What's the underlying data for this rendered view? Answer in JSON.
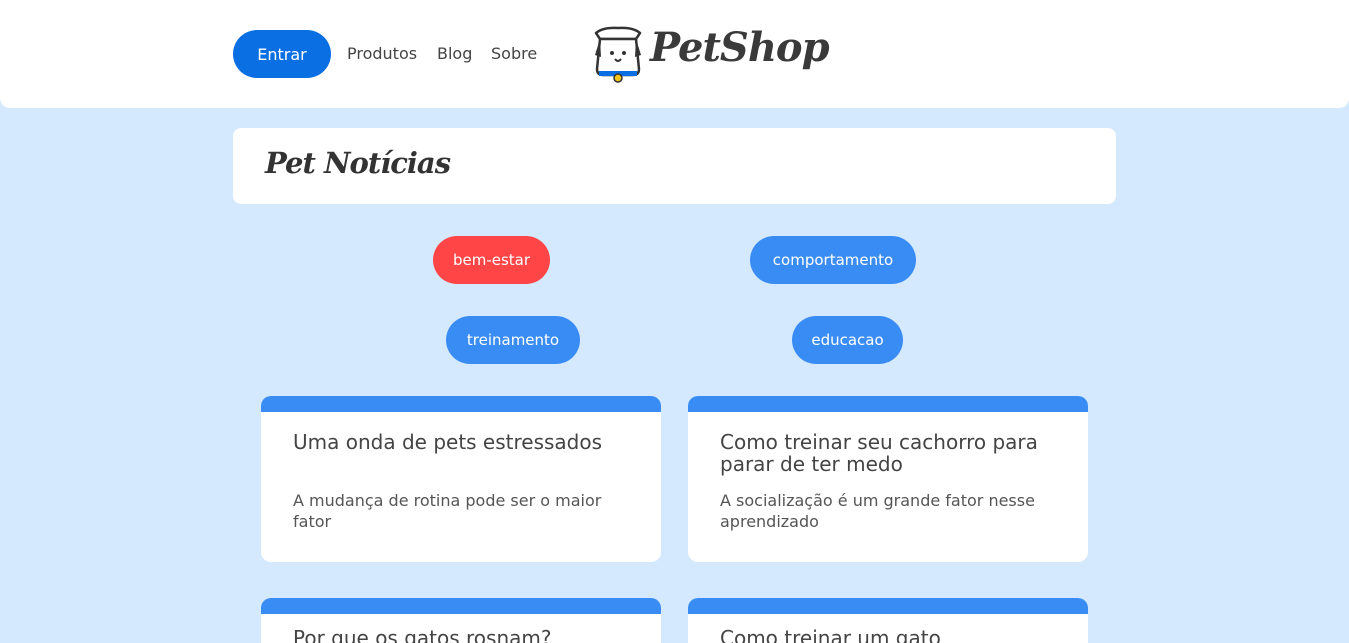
{
  "header": {
    "login_label": "Entrar",
    "nav": [
      "Produtos",
      "Blog",
      "Sobre"
    ],
    "logo_text": "PetShop"
  },
  "page": {
    "title": "Pet Notícias"
  },
  "tags": [
    {
      "label": "bem-estar",
      "color": "#ff4545"
    },
    {
      "label": "comportamento",
      "color": "#3a8cf5"
    },
    {
      "label": "treinamento",
      "color": "#3a8cf5"
    },
    {
      "label": "educacao",
      "color": "#3a8cf5"
    }
  ],
  "cards": [
    {
      "title": "Uma onda de pets estressados",
      "description": "A mudança de rotina pode ser o maior fator"
    },
    {
      "title": "Como treinar seu cachorro para parar de ter medo",
      "description": "A socialização é um grande fator nesse aprendizado"
    },
    {
      "title": "Por que os gatos rosnam?",
      "description": ""
    },
    {
      "title": "Como treinar um gato",
      "description": ""
    }
  ],
  "colors": {
    "background": "#d4e8fe",
    "primary": "#0a6fe3",
    "tag_blue": "#3a8cf5",
    "tag_red": "#ff4545"
  }
}
